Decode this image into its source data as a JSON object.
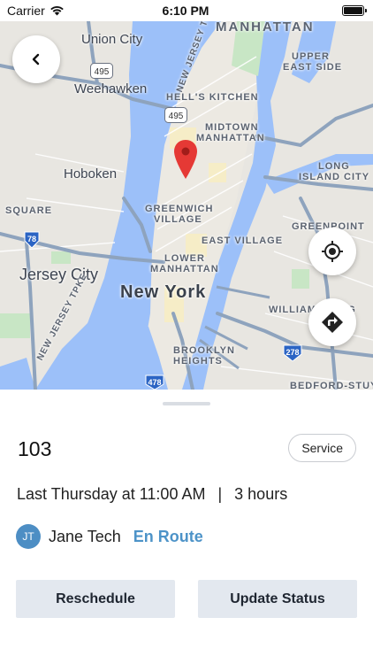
{
  "status_bar": {
    "carrier": "Carrier",
    "time": "6:10 PM",
    "wifi_icon": "wifi-icon",
    "battery_icon": "battery-icon"
  },
  "map": {
    "labels": {
      "manhattan": "MANHATTAN",
      "union_city": "Union City",
      "new_jersey_tpke": "NEW JERSEY TPKE",
      "upper_east_side_1": "UPPER",
      "upper_east_side_2": "EAST SIDE",
      "weehawken": "Weehawken",
      "hells_kitchen": "HELL'S KITCHEN",
      "midtown_1": "MIDTOWN",
      "midtown_2": "MANHATTAN",
      "hoboken": "Hoboken",
      "long_island_city_1": "LONG",
      "long_island_city_2": "ISLAND CITY",
      "square": "SQUARE",
      "greenwich_1": "GREENWICH",
      "greenwich_2": "VILLAGE",
      "greenpoint": "GREENPOINT",
      "east_village": "EAST VILLAGE",
      "jersey_city": "Jersey City",
      "lower_manhattan_1": "LOWER",
      "lower_manhattan_2": "MANHATTAN",
      "new_york": "New York",
      "williamsburg": "WILLIAMSBURG",
      "nj_tpke": "NEW JERSEY TPKE",
      "brooklyn_heights_1": "BROOKLYN",
      "brooklyn_heights_2": "HEIGHTS",
      "bedford": "BEDFORD-STUY"
    },
    "shields": {
      "i495_a": "495",
      "i495_b": "495",
      "i78": "78",
      "i278": "278",
      "i478": "478"
    },
    "colors": {
      "water": "#9cc0f9",
      "land": "#e8e6e1",
      "park": "#c8e6c5",
      "highway": "#8ea3bd",
      "pin": "#e53935"
    }
  },
  "job": {
    "number": "103",
    "type": "Service",
    "when": "Last Thursday at 11:00 AM",
    "separator": "|",
    "duration": "3 hours",
    "assignee_initials": "JT",
    "assignee_name": "Jane Tech",
    "status": "En Route",
    "status_color": "#4d93c8"
  },
  "actions": {
    "reschedule": "Reschedule",
    "update_status": "Update Status"
  }
}
